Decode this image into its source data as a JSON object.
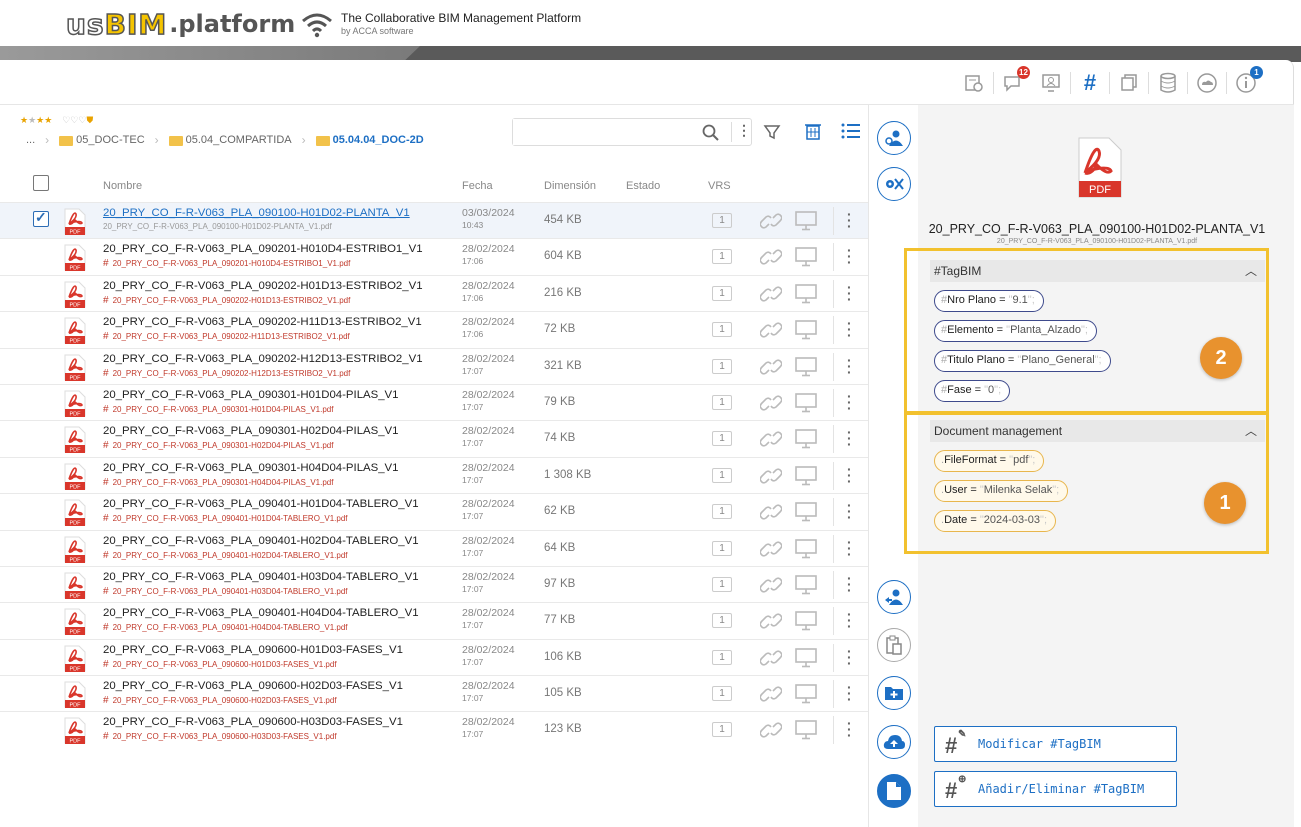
{
  "header": {
    "logo_us": "us",
    "logo_bim": "BIM",
    "logo_platform": ".platform",
    "tagline": "The Collaborative BIM Management Platform",
    "tagline_sub": "by ACCA software"
  },
  "toolbar": {
    "icons": [
      "history-icon",
      "comments-icon",
      "users-presentation-icon",
      "tagbim-hash-icon",
      "copy-icon",
      "database-icon",
      "cloud-icon",
      "info-icon"
    ],
    "comments_badge": "12",
    "info_badge": "1",
    "hash_label": "#"
  },
  "breadcrumb": {
    "ellipsis": "...",
    "items": [
      "05_DOC-TEC",
      "05.04_COMPARTIDA",
      "05.04.04_DOC-2D"
    ]
  },
  "search": {
    "value": "",
    "placeholder": ""
  },
  "table": {
    "headers": {
      "name": "Nombre",
      "date": "Fecha",
      "size": "Dimensión",
      "status": "Estado",
      "vrs": "VRS"
    },
    "rows": [
      {
        "name": "20_PRY_CO_F-R-V063_PLA_090100-H01D02-PLANTA_V1",
        "sub": "20_PRY_CO_F-R-V063_PLA_090100-H01D02-PLANTA_V1.pdf",
        "date": "03/03/2024",
        "time": "10:43",
        "size": "454 KB",
        "vrs": "1",
        "selected": true
      },
      {
        "name": "20_PRY_CO_F-R-V063_PLA_090201-H010D4-ESTRIBO1_V1",
        "sub": "20_PRY_CO_F-R-V063_PLA_090201-H010D4-ESTRIBO1_V1.pdf",
        "date": "28/02/2024",
        "time": "17:06",
        "size": "604 KB",
        "vrs": "1"
      },
      {
        "name": "20_PRY_CO_F-R-V063_PLA_090202-H01D13-ESTRIBO2_V1",
        "sub": "20_PRY_CO_F-R-V063_PLA_090202-H01D13-ESTRIBO2_V1.pdf",
        "date": "28/02/2024",
        "time": "17:06",
        "size": "216 KB",
        "vrs": "1"
      },
      {
        "name": "20_PRY_CO_F-R-V063_PLA_090202-H11D13-ESTRIBO2_V1",
        "sub": "20_PRY_CO_F-R-V063_PLA_090202-H11D13-ESTRIBO2_V1.pdf",
        "date": "28/02/2024",
        "time": "17:06",
        "size": "72 KB",
        "vrs": "1"
      },
      {
        "name": "20_PRY_CO_F-R-V063_PLA_090202-H12D13-ESTRIBO2_V1",
        "sub": "20_PRY_CO_F-R-V063_PLA_090202-H12D13-ESTRIBO2_V1.pdf",
        "date": "28/02/2024",
        "time": "17:07",
        "size": "321 KB",
        "vrs": "1"
      },
      {
        "name": "20_PRY_CO_F-R-V063_PLA_090301-H01D04-PILAS_V1",
        "sub": "20_PRY_CO_F-R-V063_PLA_090301-H01D04-PILAS_V1.pdf",
        "date": "28/02/2024",
        "time": "17:07",
        "size": "79 KB",
        "vrs": "1"
      },
      {
        "name": "20_PRY_CO_F-R-V063_PLA_090301-H02D04-PILAS_V1",
        "sub": "20_PRY_CO_F-R-V063_PLA_090301-H02D04-PILAS_V1.pdf",
        "date": "28/02/2024",
        "time": "17:07",
        "size": "74 KB",
        "vrs": "1"
      },
      {
        "name": "20_PRY_CO_F-R-V063_PLA_090301-H04D04-PILAS_V1",
        "sub": "20_PRY_CO_F-R-V063_PLA_090301-H04D04-PILAS_V1.pdf",
        "date": "28/02/2024",
        "time": "17:07",
        "size": "1 308 KB",
        "vrs": "1"
      },
      {
        "name": "20_PRY_CO_F-R-V063_PLA_090401-H01D04-TABLERO_V1",
        "sub": "20_PRY_CO_F-R-V063_PLA_090401-H01D04-TABLERO_V1.pdf",
        "date": "28/02/2024",
        "time": "17:07",
        "size": "62 KB",
        "vrs": "1"
      },
      {
        "name": "20_PRY_CO_F-R-V063_PLA_090401-H02D04-TABLERO_V1",
        "sub": "20_PRY_CO_F-R-V063_PLA_090401-H02D04-TABLERO_V1.pdf",
        "date": "28/02/2024",
        "time": "17:07",
        "size": "64 KB",
        "vrs": "1"
      },
      {
        "name": "20_PRY_CO_F-R-V063_PLA_090401-H03D04-TABLERO_V1",
        "sub": "20_PRY_CO_F-R-V063_PLA_090401-H03D04-TABLERO_V1.pdf",
        "date": "28/02/2024",
        "time": "17:07",
        "size": "97 KB",
        "vrs": "1"
      },
      {
        "name": "20_PRY_CO_F-R-V063_PLA_090401-H04D04-TABLERO_V1",
        "sub": "20_PRY_CO_F-R-V063_PLA_090401-H04D04-TABLERO_V1.pdf",
        "date": "28/02/2024",
        "time": "17:07",
        "size": "77 KB",
        "vrs": "1"
      },
      {
        "name": "20_PRY_CO_F-R-V063_PLA_090600-H01D03-FASES_V1",
        "sub": "20_PRY_CO_F-R-V063_PLA_090600-H01D03-FASES_V1.pdf",
        "date": "28/02/2024",
        "time": "17:07",
        "size": "106 KB",
        "vrs": "1"
      },
      {
        "name": "20_PRY_CO_F-R-V063_PLA_090600-H02D03-FASES_V1",
        "sub": "20_PRY_CO_F-R-V063_PLA_090600-H02D03-FASES_V1.pdf",
        "date": "28/02/2024",
        "time": "17:07",
        "size": "105 KB",
        "vrs": "1"
      },
      {
        "name": "20_PRY_CO_F-R-V063_PLA_090600-H03D03-FASES_V1",
        "sub": "20_PRY_CO_F-R-V063_PLA_090600-H03D03-FASES_V1.pdf",
        "date": "28/02/2024",
        "time": "17:07",
        "size": "123 KB",
        "vrs": "1"
      }
    ]
  },
  "details": {
    "pdf_label": "PDF",
    "title": "20_PRY_CO_F-R-V063_PLA_090100-H01D02-PLANTA_V1",
    "subtitle": "20_PRY_CO_F-R-V063_PLA_090100-H01D02-PLANTA_V1.pdf",
    "tagbim": {
      "heading": "#TagBIM",
      "chips": [
        {
          "key": "Nro Plano",
          "value": "9.1"
        },
        {
          "key": "Elemento",
          "value": "Planta_Alzado"
        },
        {
          "key": "Titulo Plano",
          "value": "Plano_General"
        },
        {
          "key": "Fase",
          "value": "0"
        }
      ]
    },
    "docmgmt": {
      "heading": "Document management",
      "chips": [
        {
          "key": "FileFormat",
          "value": "pdf"
        },
        {
          "key": "User",
          "value": "Milenka Selak"
        },
        {
          "key": "Date",
          "value": "2024-03-03"
        }
      ]
    },
    "badge_2": "2",
    "badge_1": "1",
    "buttons": {
      "modify": "Modificar #TagBIM",
      "add_remove": "Añadir/Eliminar #TagBIM"
    }
  },
  "colors": {
    "accent": "#1d6fc4",
    "highlight": "#f2c12e",
    "badge": "#e8922e",
    "pdf_red": "#c0392b"
  }
}
